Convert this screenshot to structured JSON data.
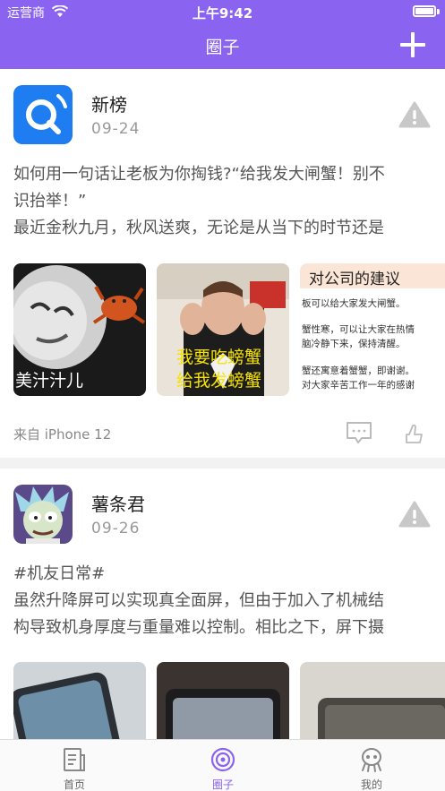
{
  "status_bar": {
    "carrier": "运营商",
    "time": "上午9:42"
  },
  "header": {
    "title": "圈子"
  },
  "posts": [
    {
      "author": "新榜",
      "date": "09-24",
      "lines": [
        "如何用一句话让老板为你掏钱?“给我发大闸蟹！别不",
        "识抬举！”",
        "最近金秋九月，秋风送爽，无论是从当下的时节还是"
      ],
      "images": [
        {
          "caption": "美汁汁儿"
        },
        {
          "caption_line1": "我要吃螃蟹",
          "caption_line2": "给我发螃蟹"
        },
        {
          "doc_title": "对公司的建议",
          "doc_lines": [
            "板可以给大家发大闸蟹。",
            "蟹性寒，可以让大家在热情",
            "脑冷静下来，保持清醒。",
            "蟹还寓意着蟹蟹，即谢谢。",
            "对大家辛苦工作一年的感谢"
          ]
        }
      ],
      "source": "来自 iPhone 12"
    },
    {
      "author": "薯条君",
      "date": "09-26",
      "lines": [
        "#机友日常#",
        "虽然升降屏可以实现真全面屏，但由于加入了机械结",
        "构导致机身厚度与重量难以控制。相比之下，屏下摄"
      ]
    }
  ],
  "tabbar": {
    "items": [
      {
        "label": "首页",
        "icon": "document-icon"
      },
      {
        "label": "圈子",
        "icon": "circle-icon"
      },
      {
        "label": "我的",
        "icon": "alien-icon"
      }
    ],
    "active": "圈子"
  },
  "colors": {
    "accent": "#8a63f0",
    "brand_blue": "#1e7df0"
  }
}
